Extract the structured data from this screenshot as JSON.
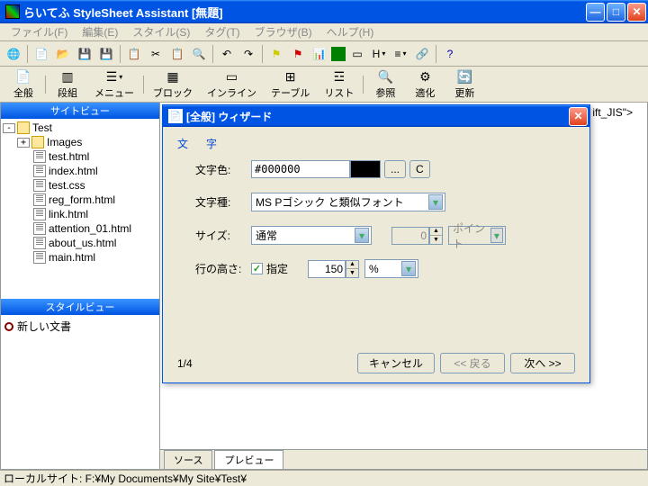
{
  "window": {
    "title": "らいてふ StyleSheet Assistant  [無題]"
  },
  "menu": {
    "file": "ファイル(F)",
    "edit": "編集(E)",
    "style": "スタイル(S)",
    "tag": "タグ(T)",
    "browser": "ブラウザ(B)",
    "help": "ヘルプ(H)"
  },
  "bigtb": {
    "general": "全般",
    "columns": "段組",
    "menu": "メニュー",
    "block": "ブロック",
    "inline": "インライン",
    "table": "テーブル",
    "list": "リスト",
    "ref": "参照",
    "optimize": "適化",
    "update": "更新"
  },
  "sidebar": {
    "siteview": "サイトビュー",
    "styleview": "スタイルビュー",
    "root": "Test",
    "images": "Images",
    "files": [
      "test.html",
      "index.html",
      "test.css",
      "reg_form.html",
      "link.html",
      "attention_01.html",
      "about_us.html",
      "main.html"
    ],
    "newdoc": "新しい文書"
  },
  "editor": {
    "line": "ift_JIS\">"
  },
  "tabs": {
    "source": "ソース",
    "preview": "プレビュー"
  },
  "status": {
    "text": "ローカルサイト: F:¥My Documents¥My Site¥Test¥"
  },
  "wizard": {
    "title": "[全般] ウィザード",
    "section": "文　字",
    "labels": {
      "color": "文字色:",
      "font": "文字種:",
      "size": "サイズ:",
      "lineheight": "行の高さ:"
    },
    "colorValue": "#000000",
    "btn_ellipsis": "...",
    "btn_c": "C",
    "fontValue": "MS Pゴシック と類似フォント",
    "sizeValue": "通常",
    "sizeNum": "0",
    "sizeUnit": "ポイント",
    "specify": "指定",
    "lhValue": "150",
    "lhUnit": "%",
    "page": "1/4",
    "cancel": "キャンセル",
    "back": "<< 戻る",
    "next": "次へ >>"
  }
}
